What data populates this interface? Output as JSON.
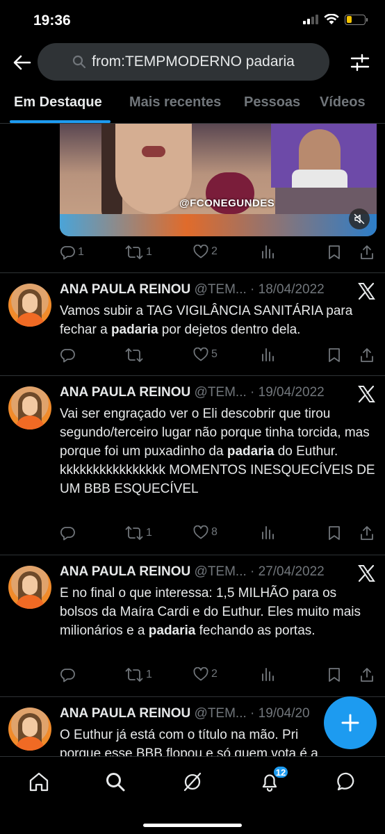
{
  "status_bar": {
    "time": "19:36"
  },
  "search": {
    "query": "from:TEMPMODERNO padaria"
  },
  "tabs": [
    {
      "label": "Em Destaque"
    },
    {
      "label": "Mais recentes"
    },
    {
      "label": "Pessoas"
    },
    {
      "label": "Vídeos"
    }
  ],
  "media": {
    "watermark": "@FCONEGUNDES"
  },
  "first_tweet_actions": {
    "replies": "1",
    "retweets": "1",
    "likes": "2"
  },
  "tweets": [
    {
      "name": "ANA PAULA REINOU",
      "meta": "@TEM... · 18/04/2022",
      "text_parts": [
        "Vamos subir a TAG VIGILÂNCIA SANITÁRIA para fechar a ",
        "padaria",
        " por dejetos dentro dela."
      ],
      "replies": "",
      "retweets": "",
      "likes": "5"
    },
    {
      "name": "ANA PAULA REINOU",
      "meta": "@TEM... · 19/04/2022",
      "text_parts": [
        "Vai ser engraçado ver o Eli descobrir que tirou segundo/terceiro lugar não porque tinha torcida, mas porque foi um puxadinho da ",
        "padaria",
        " do Euthur. kkkkkkkkkkkkkkkk MOMENTOS INESQUECÍVEIS DE UM BBB ESQUECÍVEL"
      ],
      "replies": "",
      "retweets": "1",
      "likes": "8"
    },
    {
      "name": "ANA PAULA REINOU",
      "meta": "@TEM... · 27/04/2022",
      "text_parts": [
        "E no final o que interessa: 1,5 MILHÃO para os bolsos da Maíra Cardi e do Euthur. Eles muito mais milionários e a ",
        "padaria",
        " fechando as portas."
      ],
      "replies": "",
      "retweets": "1",
      "likes": "2"
    },
    {
      "name": "ANA PAULA REINOU",
      "meta": "@TEM... · 19/04/20",
      "text_parts": [
        "O Euthur já está com o título na mão. Pri",
        "",
        "porque esse BBB flopou e só quem vota é a tal"
      ],
      "replies": "",
      "retweets": "",
      "likes": ""
    }
  ],
  "nav": {
    "notifications_badge": "12"
  },
  "colors": {
    "accent": "#1d9bf0",
    "background": "#000000",
    "muted": "#71767b",
    "text": "#e7e9ea"
  }
}
